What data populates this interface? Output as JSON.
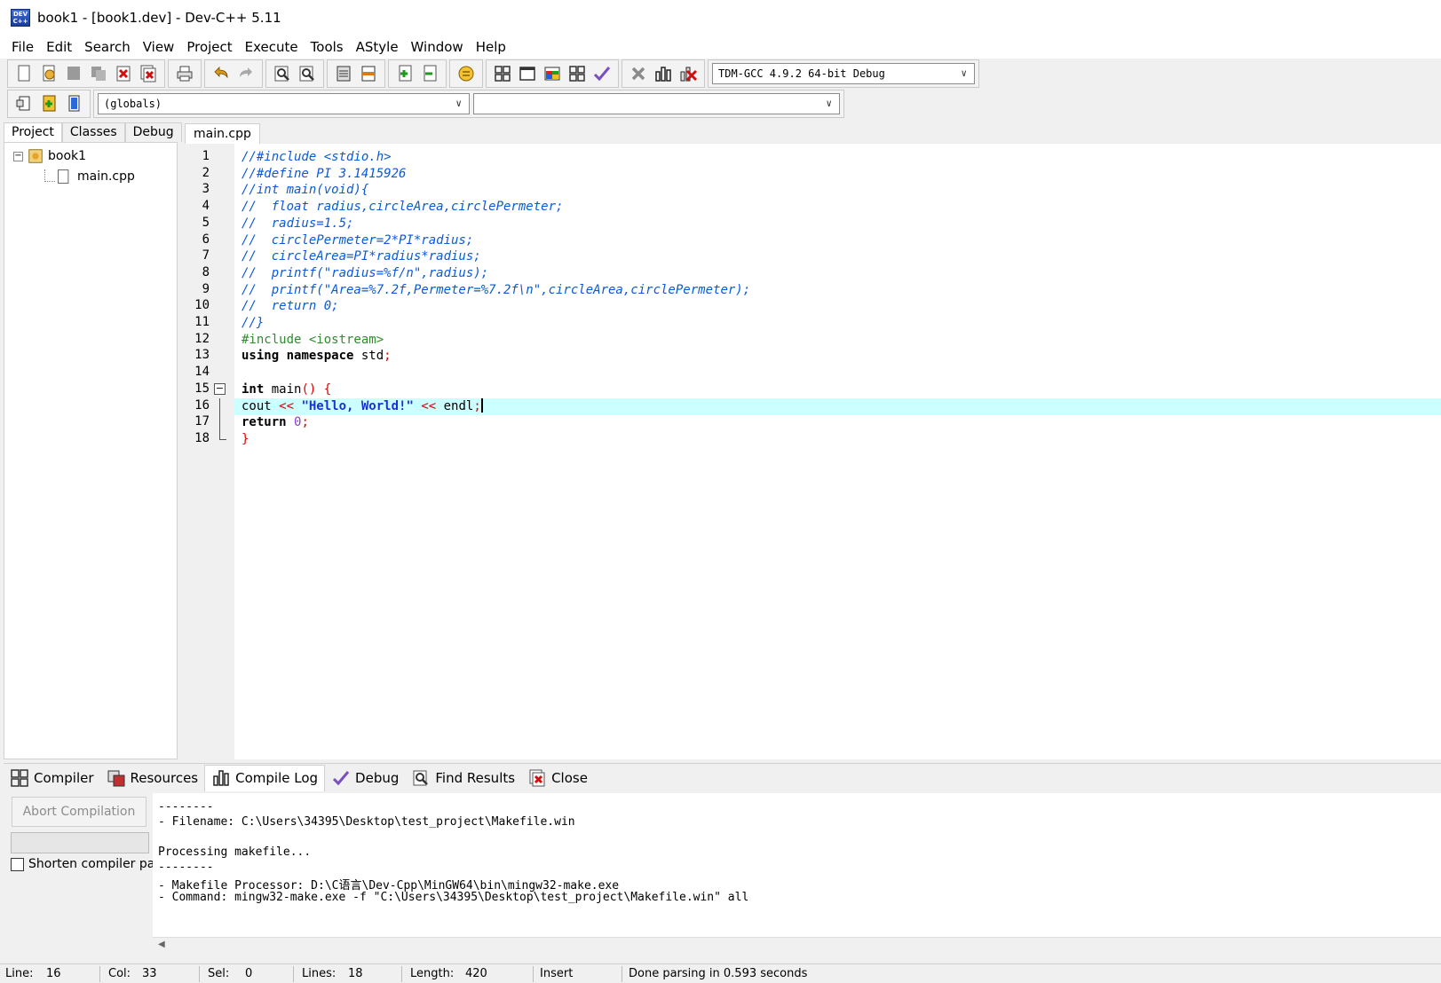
{
  "window": {
    "title": "book1 - [book1.dev] - Dev-C++ 5.11",
    "app_badge": "DEV C++"
  },
  "menu": [
    "File",
    "Edit",
    "Search",
    "View",
    "Project",
    "Execute",
    "Tools",
    "AStyle",
    "Window",
    "Help"
  ],
  "toolbar": {
    "compiler_select": "TDM-GCC 4.9.2 64-bit Debug",
    "scope_select": "(globals)",
    "member_select": ""
  },
  "left_panel": {
    "tabs": [
      "Project",
      "Classes",
      "Debug"
    ],
    "active_tab": "Project",
    "tree": {
      "project": "book1",
      "file": "main.cpp"
    }
  },
  "editor": {
    "tab": "main.cpp",
    "lines": [
      "//#include <stdio.h>",
      "//#define PI 3.1415926",
      "//int main(void){",
      "//  float radius,circleArea,circlePermeter;",
      "//  radius=1.5;",
      "//  circlePermeter=2*PI*radius;",
      "//  circleArea=PI*radius*radius;",
      "//  printf(\"radius=%f/n\",radius);",
      "//  printf(\"Area=%7.2f,Permeter=%7.2f\\n\",circleArea,circlePermeter);",
      "//  return 0;",
      "//}",
      "#include <iostream>",
      "using namespace std;",
      "",
      "int main() {",
      "cout << \"Hello, World!\" << endl;",
      "return 0;",
      "}"
    ],
    "current_line": 16
  },
  "bottom_tabs": [
    "Compiler",
    "Resources",
    "Compile Log",
    "Debug",
    "Find Results",
    "Close"
  ],
  "bottom_active": "Compile Log",
  "compile_panel": {
    "abort_label": "Abort Compilation",
    "shorten_label": "Shorten compiler paths",
    "log": [
      "--------",
      "- Filename: C:\\Users\\34395\\Desktop\\test_project\\Makefile.win",
      "",
      "Processing makefile...",
      "--------",
      "- Makefile Processor: D:\\C语言\\Dev-Cpp\\MinGW64\\bin\\mingw32-make.exe",
      "- Command: mingw32-make.exe -f \"C:\\Users\\34395\\Desktop\\test_project\\Makefile.win\" all"
    ]
  },
  "status": {
    "line_label": "Line:",
    "line_value": "16",
    "col_label": "Col:",
    "col_value": "33",
    "sel_label": "Sel:",
    "sel_value": "0",
    "lines_label": "Lines:",
    "lines_value": "18",
    "length_label": "Length:",
    "length_value": "420",
    "mode": "Insert",
    "message": "Done parsing in 0.593 seconds"
  }
}
